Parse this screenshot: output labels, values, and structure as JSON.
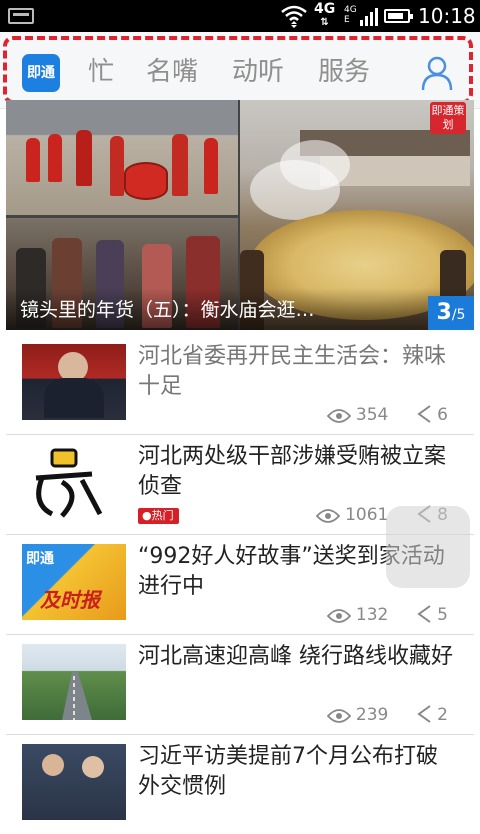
{
  "status_bar": {
    "net_type": "4G",
    "sub_net": "4G",
    "time": "10:18",
    "battery_level": 0.85
  },
  "header": {
    "logo_text": "即通",
    "tabs": [
      "忙",
      "名嘴",
      "动听",
      "服务"
    ],
    "icons": {
      "profile": "user-icon"
    }
  },
  "carousel": {
    "caption": "镜头里的年货（五）：衡水庙会逛…",
    "current": "3",
    "total": "/5",
    "corner_tag": "即通策划"
  },
  "news": [
    {
      "title": "河北省委再开民主生活会：辣味十足",
      "views": "354",
      "shares": "6",
      "read": true
    },
    {
      "title": "河北两处级干部涉嫌受贿被立案侦查",
      "views": "1061",
      "shares": "8",
      "badge": "热门"
    },
    {
      "title": "“992好人好故事”送奖到家活动进行中",
      "views": "132",
      "shares": "5",
      "thumb_logo": "即通",
      "thumb_text": "及时报"
    },
    {
      "title": "河北高速迎高峰 绕行路线收藏好",
      "views": "239",
      "shares": "2"
    },
    {
      "title": "习近平访美提前7个月公布打破外交惯例",
      "views": "",
      "shares": ""
    }
  ],
  "colors": {
    "accent": "#1d7fe0",
    "hot": "#d61f26",
    "highlight_frame": "#e0232f"
  }
}
